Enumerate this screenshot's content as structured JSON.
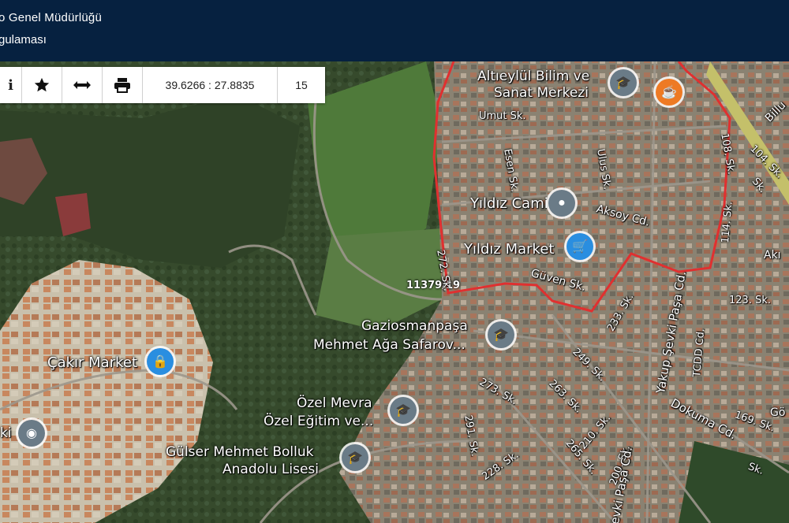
{
  "header": {
    "title_line1": "o Genel Müdürlüğü",
    "title_line2": "gulaması"
  },
  "toolbar": {
    "info_icon": "info-icon",
    "favorite_icon": "star-icon",
    "measure_icon": "horizontal-arrows-icon",
    "print_icon": "printer-icon",
    "coordinates": "39.6266 : 27.8835",
    "zoom_level": "15"
  },
  "map": {
    "parcel_label": "11379/19",
    "parcel_outline_color": "#e03030",
    "pois": [
      {
        "name": "Altıeylül Bilim ve",
        "name2": "Sanat Merkezi",
        "icon": "school-icon"
      },
      {
        "name": "Yıldız Cami",
        "icon": "mosque-icon"
      },
      {
        "name": "Yıldız Market",
        "icon": "cart-icon"
      },
      {
        "name": "Gaziosmanpaşa",
        "name2": "Mehmet Ağa Safarov...",
        "icon": "school-icon"
      },
      {
        "name": "Çakır Market",
        "icon": "bag-icon"
      },
      {
        "name": "Özel Mevra",
        "name2": "Özel Eğitim ve...",
        "icon": "school-icon"
      },
      {
        "name": "Gülser Mehmet Bolluk",
        "name2": "Anadolu Lisesi",
        "icon": "school-icon"
      },
      {
        "name": "ki",
        "icon": "pin-icon"
      },
      {
        "name": "",
        "icon": "cafe-icon"
      }
    ],
    "streets": [
      "Umut Sk.",
      "Esen Sk.",
      "Ulus Sk.",
      "Aksoy Cd.",
      "272. Sk.",
      "Güven Sk.",
      "233. Sk.",
      "Yakup Şevki Paşa Cd.",
      "249. Sk.",
      "263. Sk.",
      "273. Sk.",
      "291. Sk.",
      "228. Sk.",
      "210. Sk.",
      "265. Sk.",
      "200. Sk.",
      "evki Paşa Cd.",
      "TCDD Cd.",
      "Dokuma Cd.",
      "123. Sk.",
      "169. Sk.",
      "104. Sk.",
      "108. Sk.",
      "114. Sk.",
      "Billu",
      "Akı",
      "Sk.",
      "Gö",
      "Sk."
    ]
  }
}
